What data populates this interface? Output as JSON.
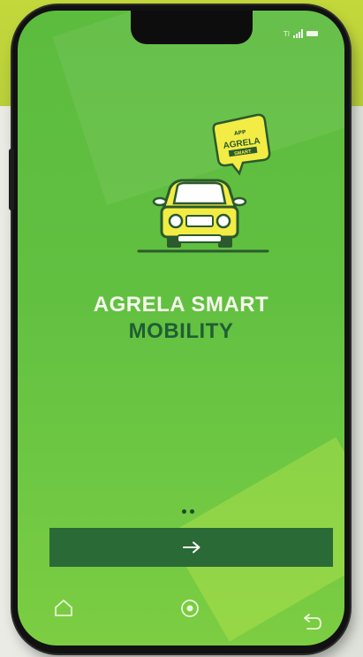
{
  "status_bar": {
    "carrier_text": "Tl",
    "icons": [
      "signal-icon",
      "battery-icon"
    ]
  },
  "logo": {
    "badge_small_text": "APP",
    "badge_text": "AGRELA",
    "badge_subtext": "SMART",
    "icon": "car-icon"
  },
  "title": {
    "line1": "AGRELA SMART",
    "line2": "MOBILITY"
  },
  "pager": {
    "dots": 2
  },
  "next_button": {
    "icon": "arrow-right-icon"
  },
  "navbar": {
    "icons": [
      "home-icon",
      "circle-button-icon",
      "back-icon"
    ]
  },
  "colors": {
    "screen_green": "#62c041",
    "title_white": "#f4f8ec",
    "title_dark_green": "#1f5f33",
    "button_green": "#2a6a36",
    "badge_yellow": "#f3ec44"
  }
}
